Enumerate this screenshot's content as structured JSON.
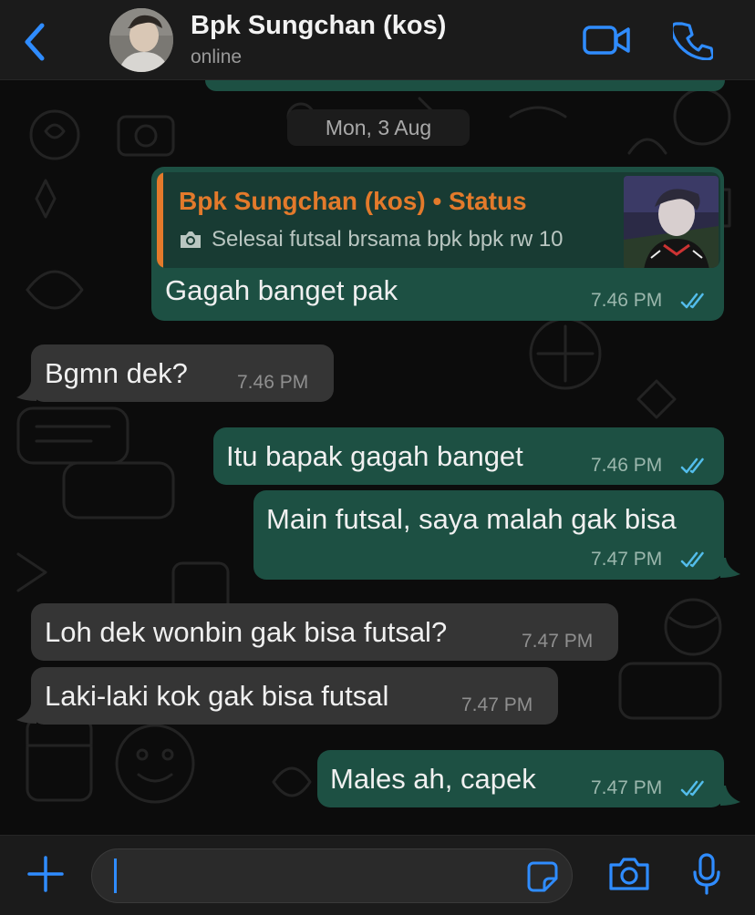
{
  "header": {
    "contact_name": "Bpk Sungchan (kos)",
    "contact_status": "online"
  },
  "date_separator": "Mon, 3 Aug",
  "quoted_status": {
    "title": "Bpk Sungchan (kos) • Status",
    "text": "Selesai futsal brsama bpk bpk rw 10"
  },
  "messages": [
    {
      "direction": "out",
      "text": "Gagah banget pak",
      "time": "7.46 PM",
      "read": true
    },
    {
      "direction": "in",
      "text": "Bgmn dek?",
      "time": "7.46 PM"
    },
    {
      "direction": "out",
      "text": "Itu bapak gagah banget",
      "time": "7.46 PM",
      "read": true
    },
    {
      "direction": "out",
      "text": "Main futsal, saya malah gak bisa",
      "time": "7.47 PM",
      "read": true
    },
    {
      "direction": "in",
      "text": "Loh dek wonbin gak bisa futsal?",
      "time": "7.47 PM"
    },
    {
      "direction": "in",
      "text": "Laki-laki kok gak bisa futsal",
      "time": "7.47 PM"
    },
    {
      "direction": "out",
      "text": "Males ah, capek",
      "time": "7.47 PM",
      "read": true
    }
  ],
  "composer": {
    "value": "",
    "placeholder": ""
  },
  "colors": {
    "accent": "#2f8cff",
    "outgoing_bubble": "#1d5043",
    "incoming_bubble": "#353535",
    "status_quote": "#e37a2b",
    "read_ticks": "#53bdeb"
  },
  "icons": [
    "back-chevron-icon",
    "video-call-icon",
    "phone-icon",
    "camera-icon",
    "plus-icon",
    "sticker-icon",
    "microphone-icon",
    "double-check-icon"
  ]
}
